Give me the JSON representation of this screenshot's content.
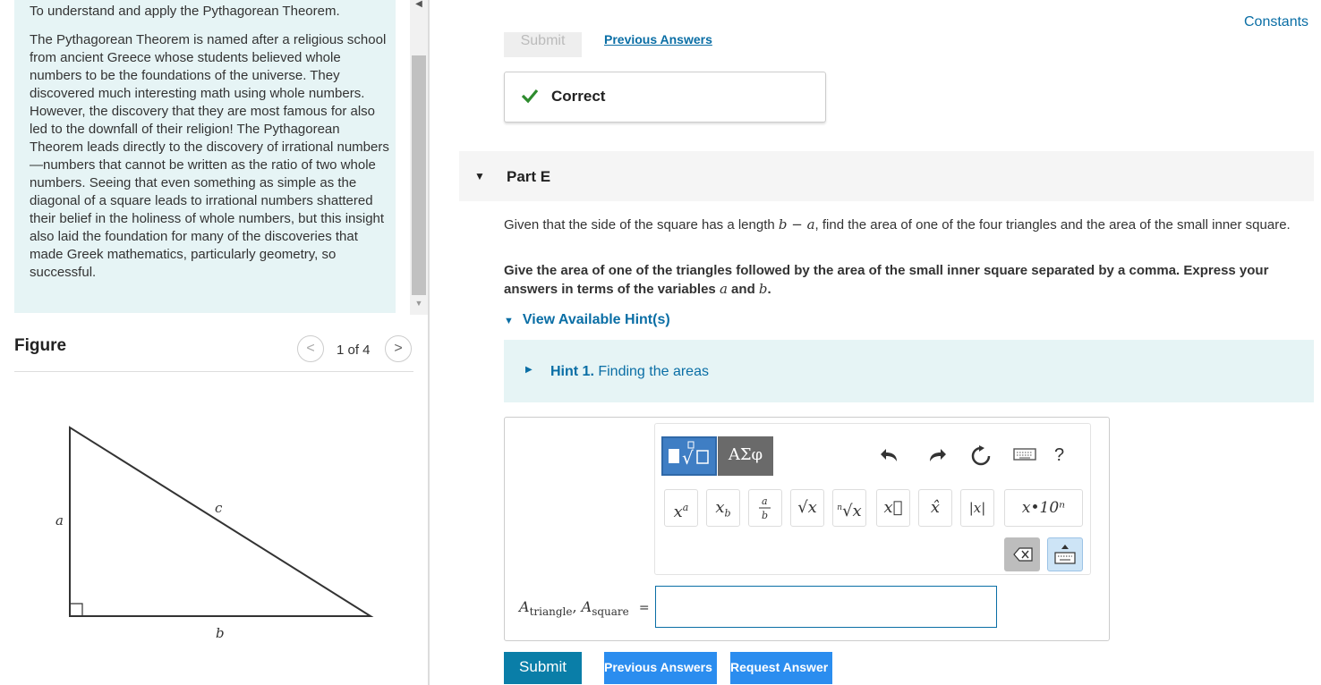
{
  "intro": {
    "title": "To understand and apply the Pythagorean Theorem.",
    "body": "The Pythagorean Theorem is named after a religious school from ancient Greece whose students believed whole numbers to be the foundations of the universe. They discovered much interesting math using whole numbers. However, the discovery that they are most famous for also led to the downfall of their religion! The Pythagorean Theorem leads directly to the discovery of irrational numbers—numbers that cannot be written as the ratio of two whole numbers. Seeing that even something as simple as the diagonal of a square leads to irrational numbers shattered their belief in the holiness of whole numbers, but this insight also laid the foundation for many of the discoveries that made Greek mathematics, particularly geometry, so successful."
  },
  "figure": {
    "label": "Figure",
    "counter": "1 of 4",
    "prev_icon": "chevron-left-icon",
    "next_icon": "chevron-right-icon",
    "side_labels": {
      "a": "a",
      "b": "b",
      "c": "c"
    }
  },
  "top": {
    "submit_label": "Submit",
    "previous_answers_label": "Previous Answers",
    "constants_label": "Constants"
  },
  "feedback": {
    "status": "Correct",
    "icon": "check-icon",
    "color": "#2e8b2e"
  },
  "part": {
    "title": "Part E",
    "question_pre": "Given that the side of the square has a length ",
    "question_math": "b − a",
    "question_post": ", find the area of one of the four triangles and the area of the small inner square.",
    "instruction_pre": "Give the area of one of the triangles followed by the area of the small inner square separated by a comma. Express your answers in terms of the variables ",
    "instruction_var_a": "a",
    "instruction_and": " and ",
    "instruction_var_b": "b",
    "instruction_end": "."
  },
  "hints": {
    "toggle_label": "View Available Hint(s)",
    "items": [
      {
        "number": "Hint 1.",
        "title": "Finding the areas"
      }
    ]
  },
  "toolbar": {
    "greek_label": "ΑΣφ",
    "help_label": "?",
    "buttons": [
      "xᵃ",
      "x_b",
      "a/b",
      "√x",
      "ⁿ√x",
      "x⃗",
      "x̂",
      "|x|",
      "x·10ⁿ"
    ],
    "sci_label": "x•10ⁿ",
    "abs_label": "|x|"
  },
  "answer": {
    "A": "A",
    "sub1": "triangle",
    "sub2": "square",
    "eq": "=",
    "value": ""
  },
  "bottom": {
    "submit_label": "Submit",
    "previous_answers_label": "Previous Answers",
    "request_answer_label": "Request Answer"
  },
  "colors": {
    "accent": "#0a6ea5",
    "submit_bg": "#0a7ea8",
    "action_blue": "#2b8def",
    "hint_bg": "#e6f4f5"
  }
}
